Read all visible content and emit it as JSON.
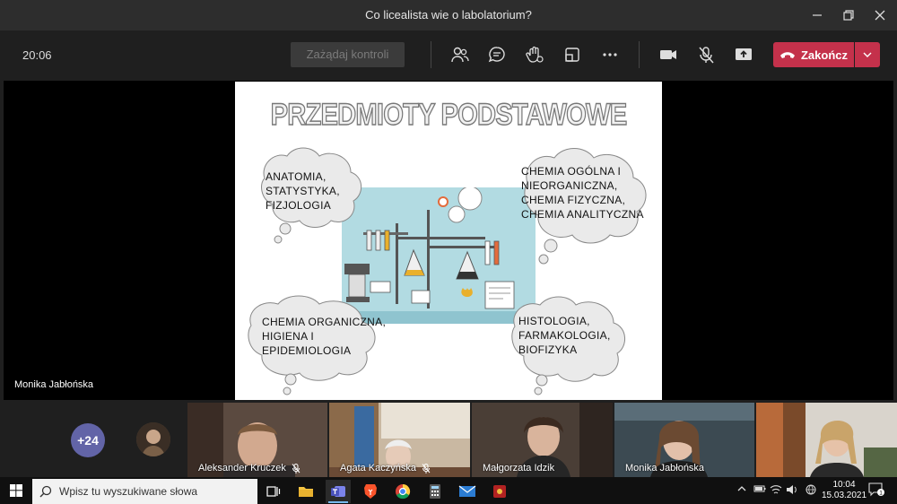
{
  "window": {
    "title": "Co licealista wie o labolatorium?"
  },
  "toolbar": {
    "timer": "20:06",
    "request_control": "Zażądaj kontroli",
    "end_call": "Zakończ"
  },
  "stage": {
    "presenter_name": "Monika Jabłońska",
    "slide": {
      "title": "PRZEDMIOTY PODSTAWOWE",
      "cloud_top_left": [
        "ANATOMIA,",
        "STATYSTYKA,",
        "FIZJOLOGIA"
      ],
      "cloud_top_right": [
        "CHEMIA OGÓLNA I",
        "NIEORGANICZNA,",
        "CHEMIA FIZYCZNA,",
        "CHEMIA ANALITYCZNA"
      ],
      "cloud_bottom_left": [
        "CHEMIA ORGANICZNA,",
        "HIGIENA I",
        "EPIDEMIOLOGIA"
      ],
      "cloud_bottom_right": [
        "HISTOLOGIA,",
        "FARMAKOLOGIA,",
        "BIOFIZYKA"
      ]
    }
  },
  "participants": {
    "overflow_count": "+24",
    "tiles": [
      {
        "name": "Aleksander Kruczek",
        "muted": true
      },
      {
        "name": "Agata Kaczyńska",
        "muted": true
      },
      {
        "name": "Małgorzata Idzik",
        "muted": false
      },
      {
        "name": "Monika Jabłońska",
        "muted": false
      },
      {
        "name": "",
        "muted": false
      }
    ]
  },
  "taskbar": {
    "search_placeholder": "Wpisz tu wyszukiwane słowa",
    "time": "10:04",
    "date": "15.03.2021",
    "notification_count": "1"
  },
  "colors": {
    "accent": "#6264a7",
    "end_call": "#c4314b",
    "lab_bg": "#b2dbe2"
  }
}
